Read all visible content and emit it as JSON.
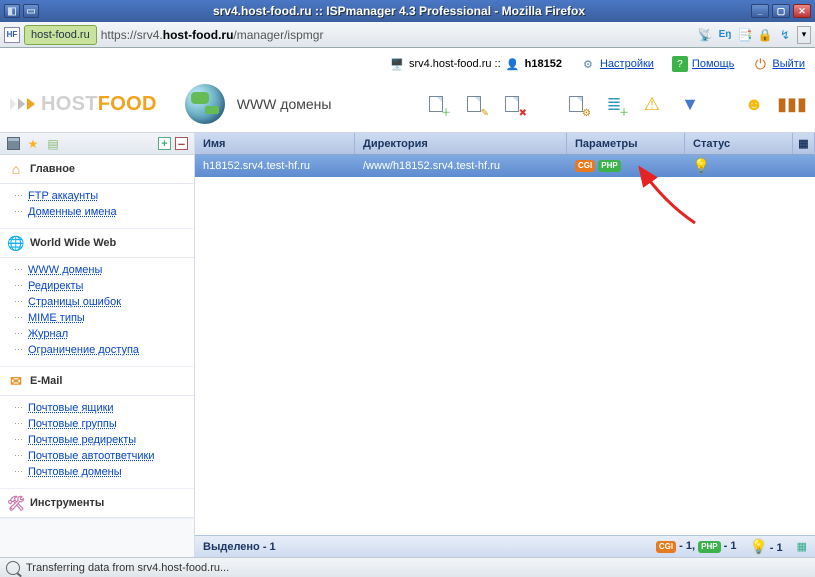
{
  "window": {
    "title": "srv4.host-food.ru :: ISPmanager 4.3 Professional - Mozilla Firefox"
  },
  "url": {
    "domain_chip": "host-food.ru",
    "prefix": "https://",
    "host_gray": "srv4.",
    "host_bold": "host-food.ru",
    "path": "/manager/ispmgr"
  },
  "top_header": {
    "server": "srv4.host-food.ru ::",
    "user": "h18152",
    "settings_label": "Настройки",
    "help_label": "Помощь",
    "logout_label": "Выйти"
  },
  "brand": {
    "name_pre": "HOST",
    "name_hl": "FOOD"
  },
  "page_title": "WWW домены",
  "columns": {
    "name": "Имя",
    "dir": "Директория",
    "params": "Параметры",
    "status": "Статус"
  },
  "row": {
    "name": "h18152.srv4.test-hf.ru",
    "dir": "/www/h18152.srv4.test-hf.ru",
    "cgi": "CGI",
    "php": "PHP"
  },
  "sidebar": {
    "main": {
      "title": "Главное",
      "items": [
        "FTP аккаунты",
        "Доменные имена"
      ]
    },
    "www": {
      "title": "World Wide Web",
      "items": [
        "WWW домены",
        "Редиректы",
        "Страницы ошибок",
        "MIME типы",
        "Журнал",
        "Ограничение доступа"
      ]
    },
    "email": {
      "title": "E-Mail",
      "items": [
        "Почтовые ящики",
        "Почтовые группы",
        "Почтовые редиректы",
        "Почтовые автоответчики",
        "Почтовые домены"
      ]
    },
    "tools": {
      "title": "Инструменты"
    }
  },
  "footer": {
    "selected": "Выделено - 1",
    "cgi_count": " - 1, ",
    "php_count": " - 1",
    "bulb_count": " - 1"
  },
  "browser_status": "Transferring data from srv4.host-food.ru..."
}
